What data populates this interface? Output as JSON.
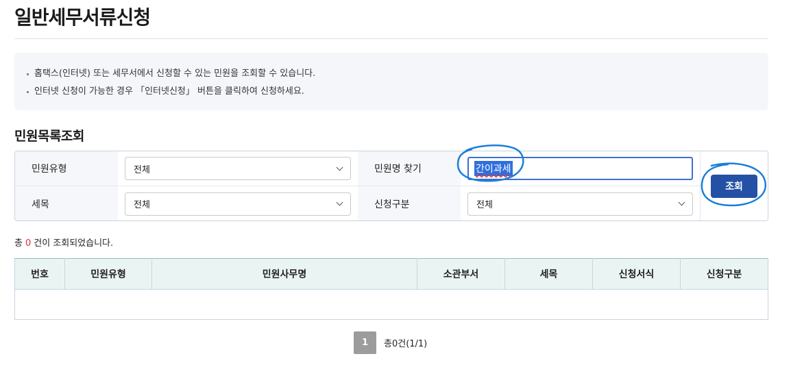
{
  "page": {
    "title": "일반세무서류신청"
  },
  "notice": {
    "lines": [
      "홈택스(인터넷) 또는 세무서에서 신청할 수 있는 민원을 조회할 수 있습니다.",
      "인터넷 신청이 가능한 경우 「인터넷신청」 버튼을 클릭하여 신청하세요."
    ]
  },
  "search": {
    "section_title": "민원목록조회",
    "fields": {
      "type": {
        "label": "민원유형",
        "value": "전체"
      },
      "name": {
        "label": "민원명 찾기",
        "value": "간이과세"
      },
      "tax_item": {
        "label": "세목",
        "value": "전체"
      },
      "apply_type": {
        "label": "신청구분",
        "value": "전체"
      }
    },
    "button_label": "조회"
  },
  "results": {
    "prefix": "총",
    "count": "0",
    "suffix": "건이 조회되었습니다.",
    "columns": [
      "번호",
      "민원유형",
      "민원사무명",
      "소관부서",
      "세목",
      "신청서식",
      "신청구분"
    ],
    "rows": []
  },
  "pagination": {
    "current_page": "1",
    "summary": "총0건(1/1)"
  },
  "colors": {
    "accent": "#2451a6",
    "header_bg": "#eaf5f3",
    "count_highlight": "#d9322b",
    "annotation": "#1a7fd8"
  }
}
